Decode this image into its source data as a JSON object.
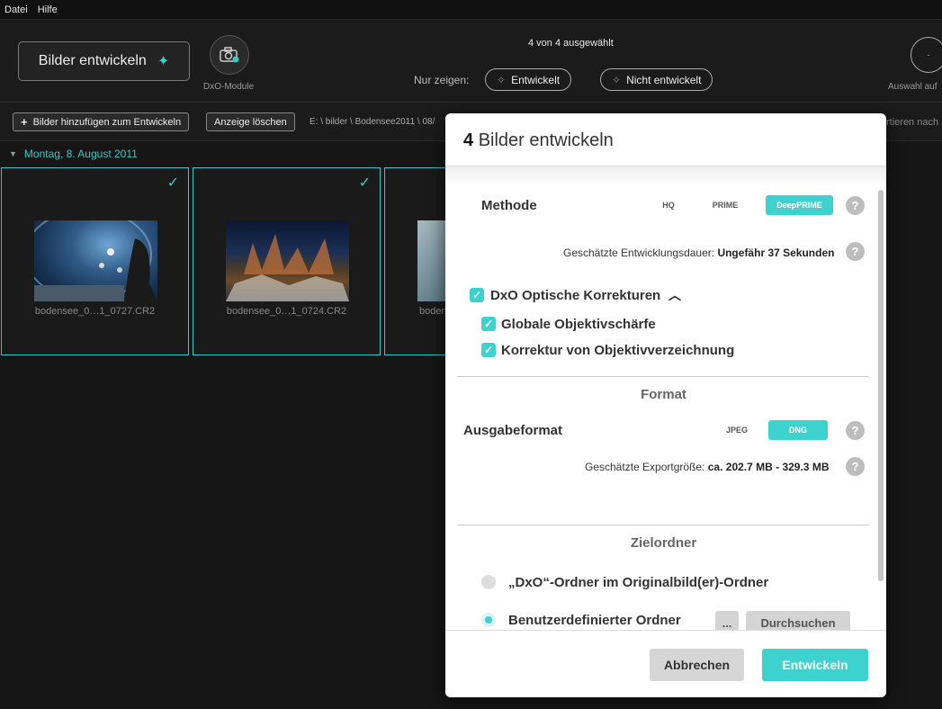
{
  "menu": {
    "file": "Datei",
    "help": "Hilfe"
  },
  "topbar": {
    "develop_button": "Bilder entwickeln",
    "dxo_module_label": "DxO-Module",
    "selection_count": "4 von 4 ausgewählt",
    "filter_label": "Nur zeigen:",
    "filter_developed": "Entwickelt",
    "filter_not_developed": "Nicht entwickelt",
    "selection_right_label": "Auswahl auf"
  },
  "toolbar": {
    "add_images": "Bilder hinzufügen zum Entwickeln",
    "clear_view": "Anzeige löschen",
    "path": "E: \\ bilder \\ Bodensee2011 \\ 08/",
    "sort_label": "rtieren nach"
  },
  "gallery": {
    "date": "Montag, 8. August 2011",
    "items": [
      {
        "name": "bodensee_0…1_0727.CR2"
      },
      {
        "name": "bodensee_0…1_0724.CR2"
      },
      {
        "name": "boden"
      }
    ]
  },
  "dialog": {
    "title_count": "4",
    "title_text": "Bilder entwickeln",
    "method_label": "Methode",
    "methods": [
      "HQ",
      "PRIME",
      "DeepPRIME"
    ],
    "estimate_label": "Geschätzte Entwicklungsdauer:",
    "estimate_value": "Ungefähr 37 Sekunden",
    "optics_label": "DxO Optische Korrekturen",
    "optics_items": [
      "Globale Objektivschärfe",
      "Korrektur von Objektivverzeichnung"
    ],
    "format_title": "Format",
    "output_label": "Ausgabeformat",
    "formats": [
      "JPEG",
      "DNG"
    ],
    "export_size_label": "Geschätzte Exportgröße:",
    "export_size_value": "ca. 202.7 MB - 329.3 MB",
    "target_title": "Zielordner",
    "target_option_1": "„DxO“-Ordner im Originalbild(er)-Ordner",
    "target_option_2": "Benutzerdefinierter Ordner",
    "dots_button": "...",
    "browse_button": "Durchsuchen",
    "cancel_button": "Abbrechen",
    "ok_button": "Entwickeln"
  },
  "colors": {
    "accent": "#3ed2cf"
  }
}
